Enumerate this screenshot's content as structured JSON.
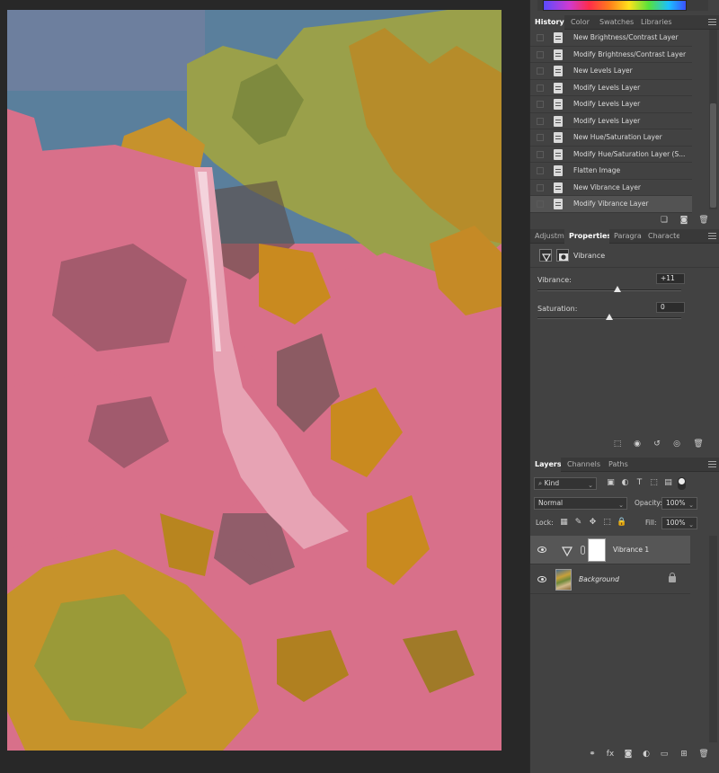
{
  "history_panel": {
    "tabs": [
      "History",
      "Color",
      "Swatches",
      "Libraries"
    ],
    "active_tab": "History",
    "items": [
      {
        "label": "New Brightness/Contrast Layer",
        "selected": false
      },
      {
        "label": "Modify Brightness/Contrast Layer",
        "selected": false
      },
      {
        "label": "New Levels Layer",
        "selected": false
      },
      {
        "label": "Modify Levels Layer",
        "selected": false
      },
      {
        "label": "Modify Levels Layer",
        "selected": false
      },
      {
        "label": "Modify Levels Layer",
        "selected": false
      },
      {
        "label": "New Hue/Saturation Layer",
        "selected": false
      },
      {
        "label": "Modify Hue/Saturation Layer (S...",
        "selected": false
      },
      {
        "label": "Flatten Image",
        "selected": false
      },
      {
        "label": "New Vibrance Layer",
        "selected": false
      },
      {
        "label": "Modify Vibrance Layer",
        "selected": true
      }
    ],
    "footer_icons": [
      "new-snapshot-icon",
      "camera-icon",
      "trash-icon"
    ]
  },
  "properties_panel": {
    "tabs": [
      "Adjustm",
      "Properties",
      "Paragra",
      "Characte"
    ],
    "active_tab": "Properties",
    "title": "Vibrance",
    "vibrance": {
      "label": "Vibrance:",
      "value": "+11",
      "level": 11,
      "min": -100,
      "max": 100
    },
    "saturation": {
      "label": "Saturation:",
      "value": "0",
      "level": 0,
      "min": -100,
      "max": 100
    },
    "footer_icons": [
      "clip-to-layer-icon",
      "view-previous-icon",
      "reset-icon",
      "visibility-icon",
      "trash-icon"
    ]
  },
  "layers_panel": {
    "tabs": [
      "Layers",
      "Channels",
      "Paths"
    ],
    "active_tab": "Layers",
    "filter_kind": "Kind",
    "blend_mode": "Normal",
    "opacity_label": "Opacity:",
    "opacity_value": "100%",
    "lock_label": "Lock:",
    "fill_label": "Fill:",
    "fill_value": "100%",
    "layers": [
      {
        "name": "Vibrance 1",
        "type": "adjustment",
        "selected": true
      },
      {
        "name": "Background",
        "type": "image",
        "selected": false,
        "locked": true
      }
    ],
    "footer_icons": [
      "link-icon",
      "fx-icon",
      "add-mask-icon",
      "adjustment-icon",
      "folder-icon",
      "new-layer-icon",
      "trash-icon"
    ]
  },
  "colors": {
    "panel_bg": "#424242",
    "tab_bar_bg": "#393939",
    "selected_row": "#535353",
    "canvas_bg": "#282828",
    "image_rock_pink": "#d8708a",
    "image_foliage_orange": "#c98a1f",
    "image_sky": "#5a7f9c"
  }
}
